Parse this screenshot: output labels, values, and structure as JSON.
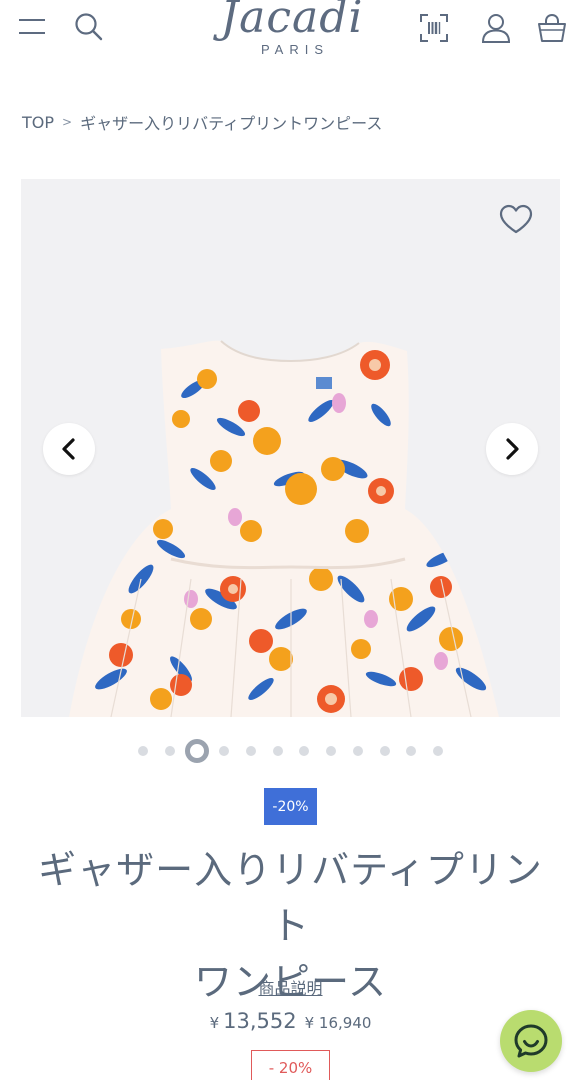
{
  "header": {
    "menu_icon": "hamburger-menu-icon",
    "search_icon": "search-icon",
    "logo_script": "Jacadi",
    "logo_sub": "PARIS",
    "scan_icon": "barcode-scan-icon",
    "account_icon": "user-icon",
    "cart_icon": "shopping-bag-icon"
  },
  "breadcrumb": {
    "home": "TOP",
    "separator": ">",
    "current": "ギャザー入りリバティプリントワンピース"
  },
  "gallery": {
    "favorite_icon": "heart-icon",
    "prev_icon": "chevron-left-icon",
    "next_icon": "chevron-right-icon",
    "slide_count": 12,
    "active_slide": 3
  },
  "product": {
    "promo_badge": "-20%",
    "title_line1": "ギャザー入りリバティプリント",
    "title_line2": "ワンピース",
    "description_link": "商品説明",
    "price_currency": "¥",
    "price_current": "13,552",
    "price_old": "¥ 16,940",
    "discount_label": "- 20%"
  },
  "chat": {
    "icon": "chat-bubble-icon"
  },
  "colors": {
    "text": "#5b6a7d",
    "promo_bg": "#3f6fd8",
    "discount": "#e05a5a",
    "chat_bg": "#b9dc6f",
    "gallery_bg": "#f1f1f3"
  }
}
